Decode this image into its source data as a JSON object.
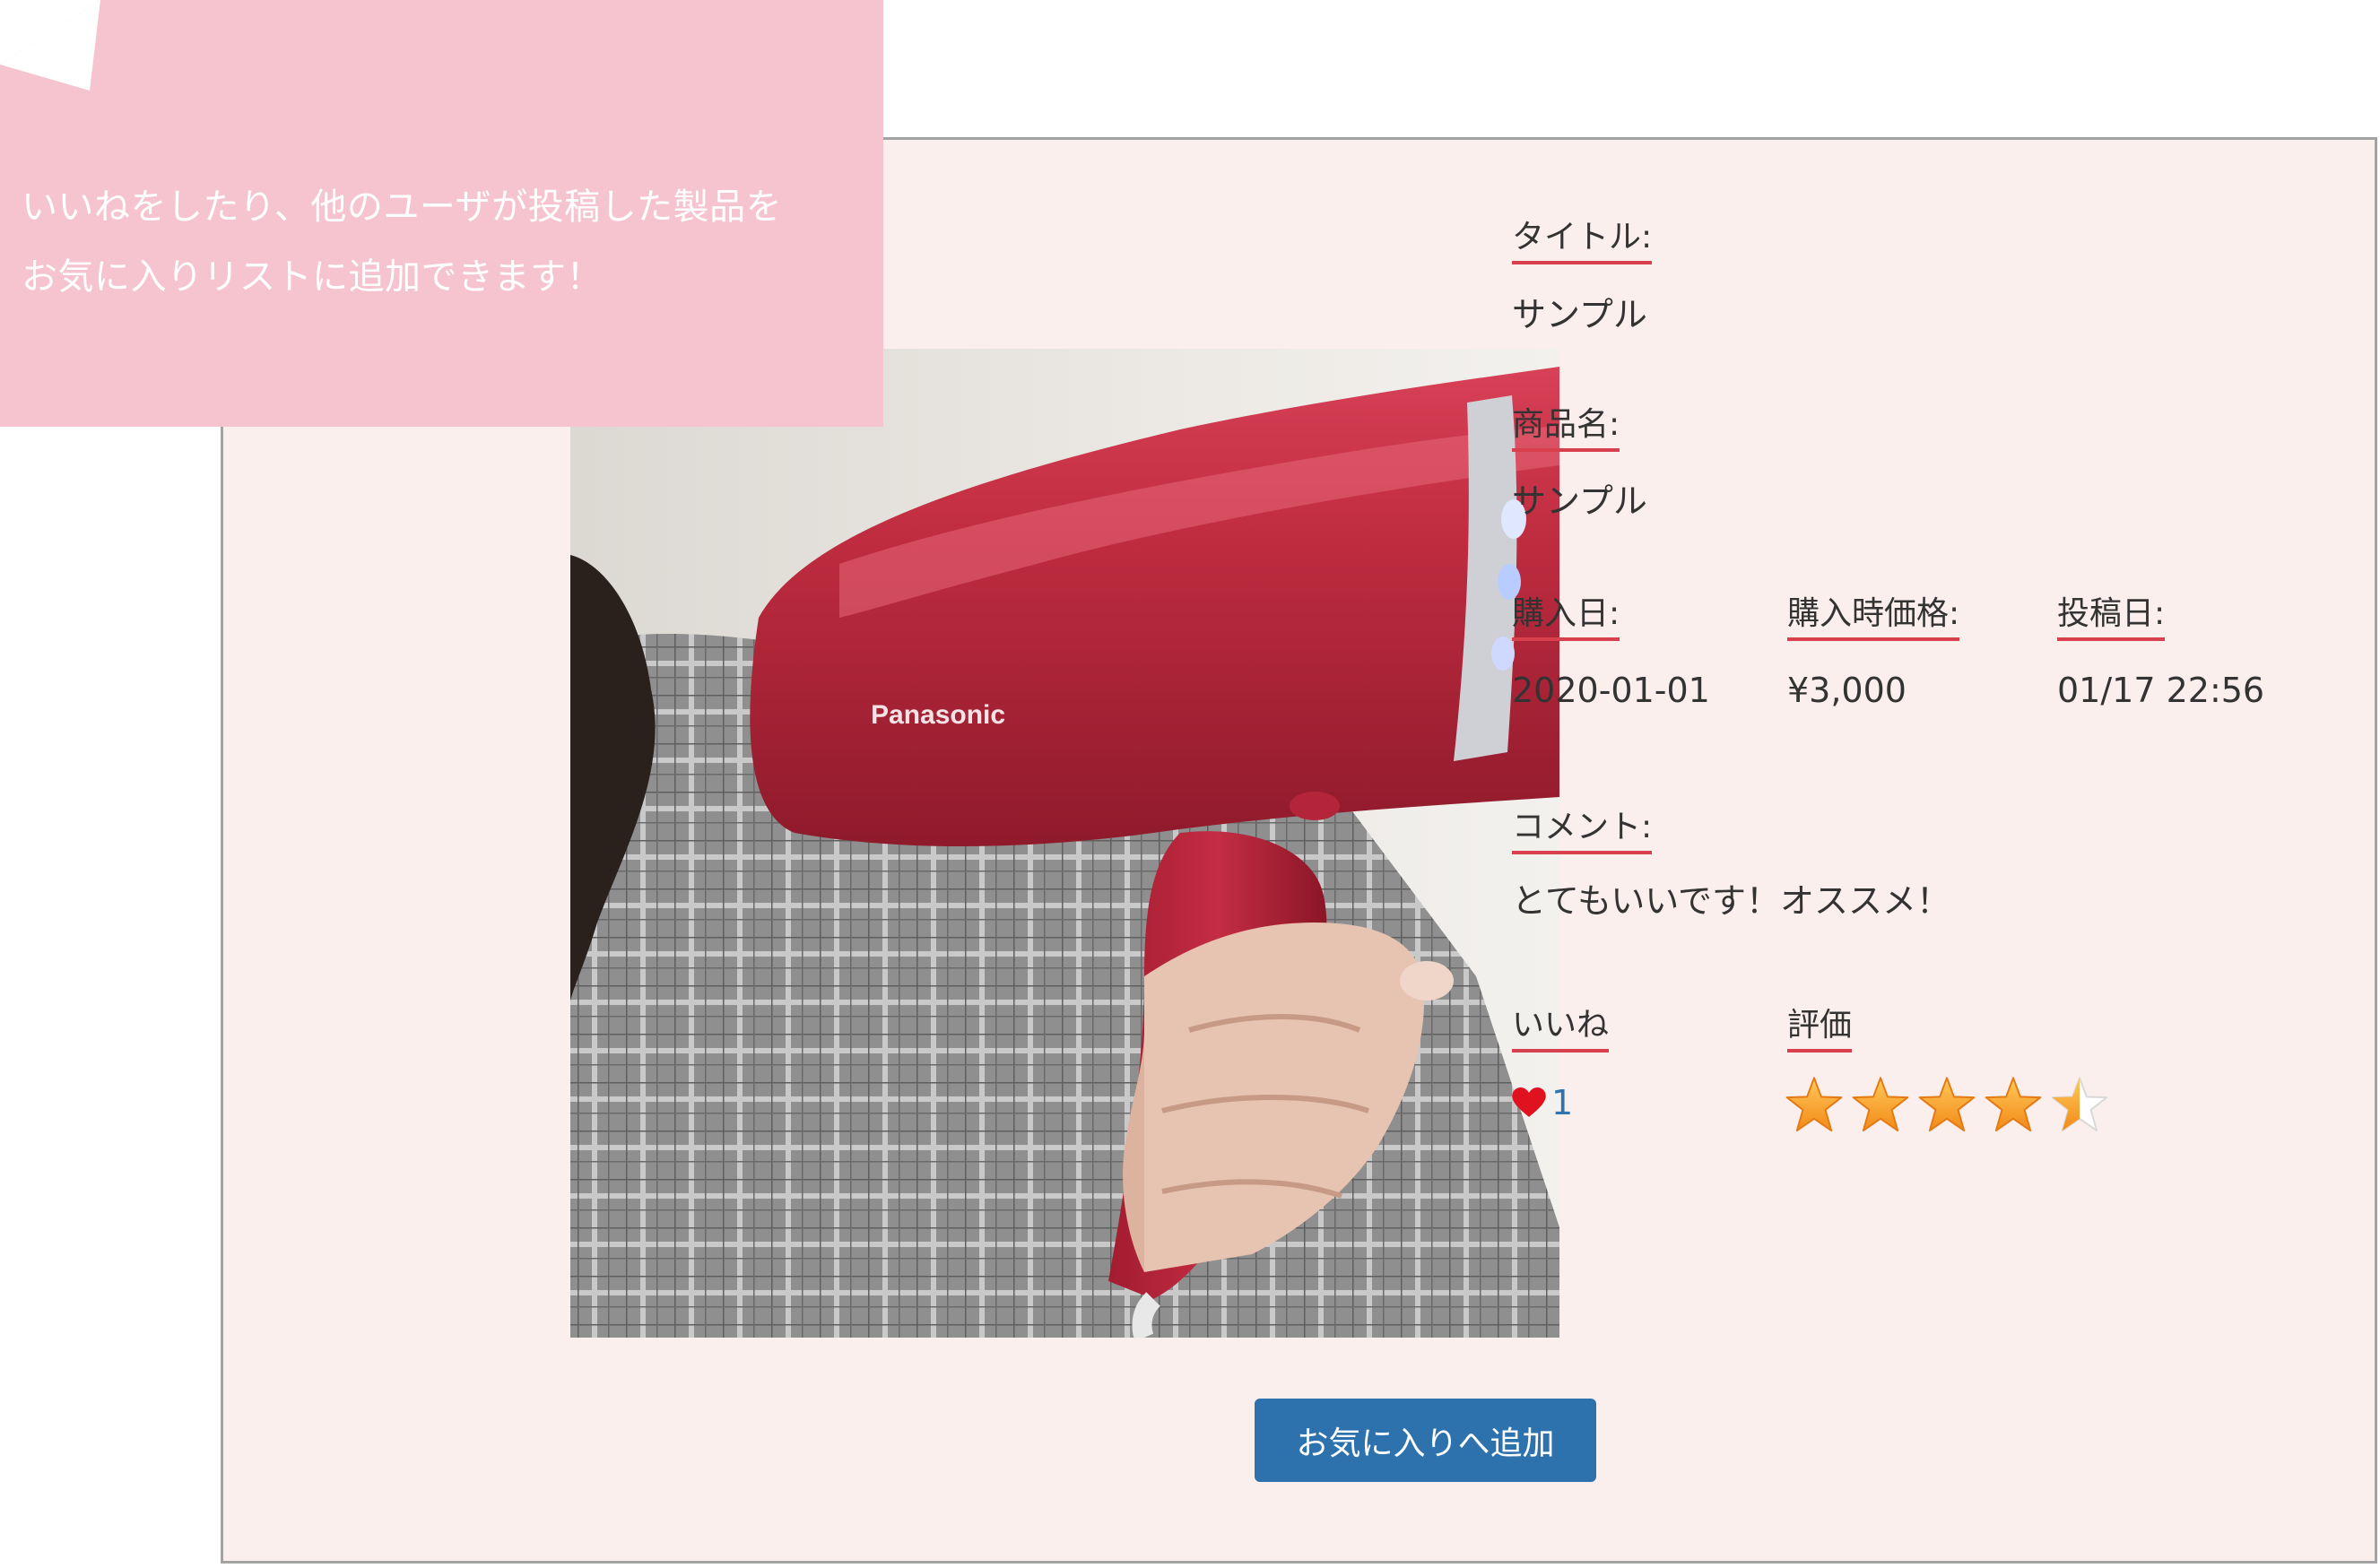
{
  "callout": {
    "line1": "いいねをしたり、他のユーザが投稿した製品を",
    "line2": "お気に入りリストに追加できます！"
  },
  "photo": {
    "icon": "product-photo-hair-dryer",
    "brand_text": "Panasonic"
  },
  "details": {
    "title_label": "タイトル:",
    "title_value": "サンプル",
    "product_label": "商品名:",
    "product_value": "サンプル",
    "purchase_date_label": "購入日:",
    "purchase_date_value": "2020-01-01",
    "purchase_price_label": "購入時価格:",
    "purchase_price_value": "¥3,000",
    "posted_label": "投稿日:",
    "posted_value": "01/17 22:56",
    "comment_label": "コメント:",
    "comment_value": "とてもいいです！オススメ！"
  },
  "likes": {
    "label": "いいね",
    "count": "1",
    "icon": "heart-icon"
  },
  "rating": {
    "label": "評価",
    "value": 4.5,
    "max": 5,
    "icon": "star-icon"
  },
  "actions": {
    "add_favorite_label": "お気に入りへ追加"
  },
  "colors": {
    "panel_bg": "#fbefed",
    "callout_bg": "#f6c4ce",
    "label_underline": "#d9404d",
    "button_bg": "#2e72ad",
    "heart": "#e0121f",
    "like_count": "#2f73b0"
  }
}
